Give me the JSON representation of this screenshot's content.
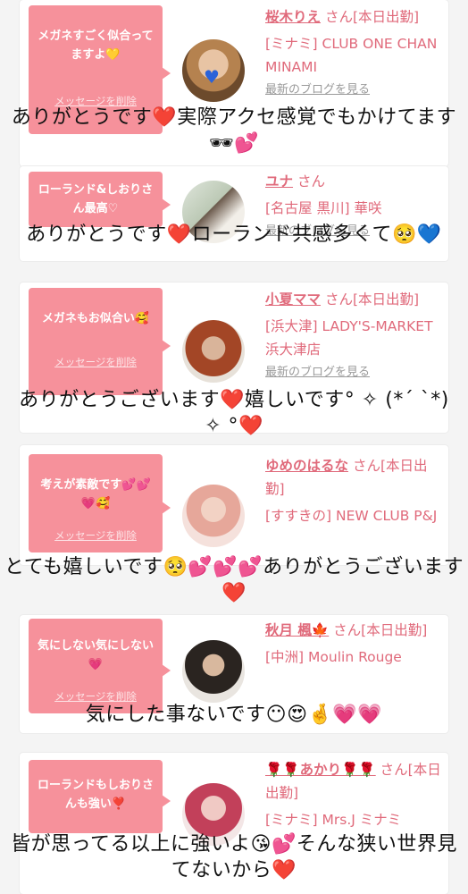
{
  "delete_label": "メッセージを削除",
  "honorific": "さん",
  "more_link": "最新のブログを見る",
  "colors": {
    "bubble": "#f6919b",
    "accent": "#e06a7b",
    "heart": "#e2142e"
  },
  "items": [
    {
      "message": "メガネすごく似合ってますよ💛",
      "name": "桜木りえ",
      "status": "[本日出勤]",
      "shop": "[ミナミ] CLUB ONE CHAN MINAMI",
      "reply": "ありがとうです❤️実際アクセ感覚でもかけてます🕶💕"
    },
    {
      "message": "ローランド&しおりさん最高♡",
      "name": "ユナ",
      "status": "",
      "shop": "[名古屋 黒川] 華咲",
      "reply": "ありがとうです❤️ローランド共感多くて🥺💙"
    },
    {
      "message": "メガネもお似合い🥰",
      "name": "小夏ママ",
      "status": "[本日出勤]",
      "shop": "[浜大津] LADY'S-MARKET 浜大津店",
      "reply": "ありがとうございます❤️嬉しいです° ✧ (*´ `*) ✧ °❤️"
    },
    {
      "message": "考えが素敵です💕💕💗🥰",
      "name": "ゆめのはるな",
      "status": "[本日出勤]",
      "shop": "[すすきの] NEW CLUB P&J",
      "reply": "とても嬉しいです🥺💕💕💕ありがとうございます❤️"
    },
    {
      "message": "気にしない気にしない💗",
      "name": "秋月 楓🍁",
      "status": "[本日出勤]",
      "shop": "[中洲] Moulin Rouge",
      "reply": "気にした事ないです😶😍🤞💗💗"
    },
    {
      "message": "ローランドもしおりさんも強い❣️",
      "name": "🌹🌹あかり🌹🌹",
      "status": "[本日出勤]",
      "shop": "[ミナミ] Mrs.J ミナミ",
      "reply": "皆が思ってる以上に強いよ😘💕そんな狭い世界見てないから❤️"
    }
  ]
}
